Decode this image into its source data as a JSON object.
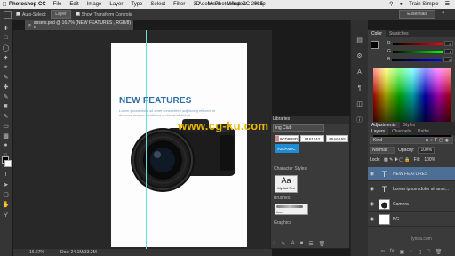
{
  "menubar": {
    "apple": "",
    "app_name": "Photoshop CC",
    "items": [
      "File",
      "Edit",
      "Image",
      "Layer",
      "Type",
      "Select",
      "Filter",
      "3D",
      "View",
      "Window",
      "Help"
    ],
    "window_title": "Adobe Photoshop CC 2015",
    "right_label": "Train Simple"
  },
  "options": {
    "auto_select": "Auto-Select:",
    "layer_select": "Layer",
    "transform": "Show Transform Controls",
    "workspace": "Essentials"
  },
  "document": {
    "tab_title": "assets.psd @ 16.7% (NEW FEATURES , RGB/8) *",
    "zoom": "16.67%",
    "doc_info": "Doc: 24.1M/33.2M"
  },
  "artboard": {
    "heading": "NEW FEATURES",
    "subtext": "Lorem ipsum dolor sit amet consectetur adipiscing elit sed do eiusmod tempor incididunt ut labore et dolore",
    "watermark": "www.cg-ku.com"
  },
  "libraries": {
    "tab": "Libraries",
    "library_name": "ing Club",
    "swatches": [
      "#CD8B8D",
      "#161142",
      "#5A6A55",
      "#2DA4DC"
    ],
    "swatch_colors": [
      "#cd8b8d",
      "#161142",
      "#5a6a55",
      "#1f8cd4"
    ],
    "char_styles_label": "Character Styles",
    "char_style_sample": "Aa",
    "char_style_name": "Myriad Pro",
    "brushes_label": "Brushes",
    "brush_name": "lines",
    "graphics_label": "Graphics"
  },
  "color_panel": {
    "tabs": [
      "Color",
      "Swatches"
    ],
    "channels": [
      {
        "label": "R",
        "value": "0"
      },
      {
        "label": "G",
        "value": "0"
      },
      {
        "label": "B",
        "value": "0"
      }
    ]
  },
  "adjustments": {
    "tabs": [
      "Adjustments",
      "Styles"
    ]
  },
  "layers_panel": {
    "tabs": [
      "Layers",
      "Channels",
      "Paths"
    ],
    "kind": "Kind",
    "blend_mode": "Normal",
    "opacity_label": "Opacity:",
    "opacity_value": "100%",
    "lock_label": "Lock:",
    "fill_label": "Fill:",
    "fill_value": "100%",
    "layers": [
      {
        "name": "NEW FEATURES",
        "type": "text",
        "selected": true
      },
      {
        "name": "Lorem ipsum dolor sit ame...",
        "type": "text",
        "selected": false
      },
      {
        "name": "Camera",
        "type": "image",
        "selected": false
      },
      {
        "name": "BG",
        "type": "fill",
        "selected": false
      }
    ]
  },
  "branding": {
    "watermark_corner": "lynda.com"
  }
}
